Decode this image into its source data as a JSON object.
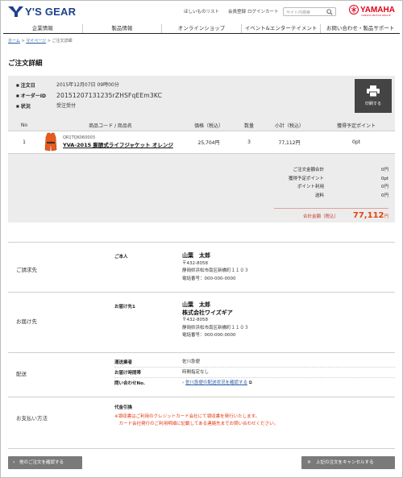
{
  "header": {
    "logo": "Y'S GEAR",
    "utility_links": [
      "ほしいものリスト",
      "会員登録",
      "ログイン",
      "カート"
    ],
    "search_placeholder": "サイト内検索",
    "yamaha": "YAMAHA",
    "yamaha_sub": "YAMAHA MOTOR GROUP"
  },
  "nav": [
    "企業情報",
    "製品情報",
    "オンラインショップ",
    "イベント&エンターテイメント",
    "お問い合わせ・製品サポート"
  ],
  "breadcrumb": [
    "ホーム",
    "マイページ",
    "ご注文詳細"
  ],
  "page_title": "ご注文詳細",
  "order": {
    "date_label": "注文日",
    "date_value": "2015年12月07日 09時00分",
    "id_label": "オーダーID",
    "id_value": "20151207131235rZHSFqEEm3KC",
    "status_label": "状況",
    "status_value": "受注受付",
    "print_label": "印刷する"
  },
  "items_table": {
    "headers": [
      "No",
      "商品コード / 商品名",
      "価格（税込）",
      "数量",
      "小計（税込）",
      "獲得予定ポイント"
    ],
    "rows": [
      {
        "no": "1",
        "code": "QR1TQK060003",
        "name": "YVA-2015 膨脹式ライフジャケット オレンジ",
        "price": "25,704円",
        "qty": "3",
        "subtotal": "77,112円",
        "points": "0pt"
      }
    ]
  },
  "totals": [
    {
      "label": "ご注文金額合計",
      "value": "0円"
    },
    {
      "label": "獲得予定ポイント",
      "value": "0pt"
    },
    {
      "label": "ポイント利用",
      "value": "0円"
    },
    {
      "label": "送料",
      "value": "0円"
    }
  ],
  "grand_total": {
    "label": "合計金額（税込）",
    "value": "77,112",
    "unit": "円"
  },
  "billing": {
    "title": "ご請求先",
    "sub": "ご本人",
    "name": "山葉　太郎",
    "zip": "〒432-8058",
    "address": "静岡県浜松市南区新橋町１１０３",
    "phone": "電話番号：000-000-0000"
  },
  "shipping": {
    "title": "お届け先",
    "sub": "お届け先1",
    "name": "山葉　太郎",
    "company": "株式会社ワイズギア",
    "zip": "〒432-8058",
    "address": "静岡県浜松市南区新橋町１１０３",
    "phone": "電話番号：000-000-0000"
  },
  "delivery": {
    "title": "配送",
    "carrier_label": "運送業者",
    "carrier_value": "佐川急便",
    "time_label": "お届け時間帯",
    "time_value": "時間指定なし",
    "inquiry_label": "問い合わせNo.",
    "inquiry_link": "佐川急便の配送状況を確認する"
  },
  "payment": {
    "title": "お支払い方法",
    "method": "代金引換",
    "note1": "※領収書はご利用のクレジットカード会社にて領収書を発行いたします。",
    "note2": "　カード会社発行のご利用明細に記載してある連絡先までお問い合わせください。"
  },
  "buttons": {
    "back": "他のご注文を確認する",
    "cancel": "上記の注文をキャンセルする"
  },
  "colors": {
    "brand_blue": "#1e3f8c",
    "yamaha_red": "#e2001a",
    "total_orange": "#e04411",
    "warn_red": "#e2340f"
  }
}
